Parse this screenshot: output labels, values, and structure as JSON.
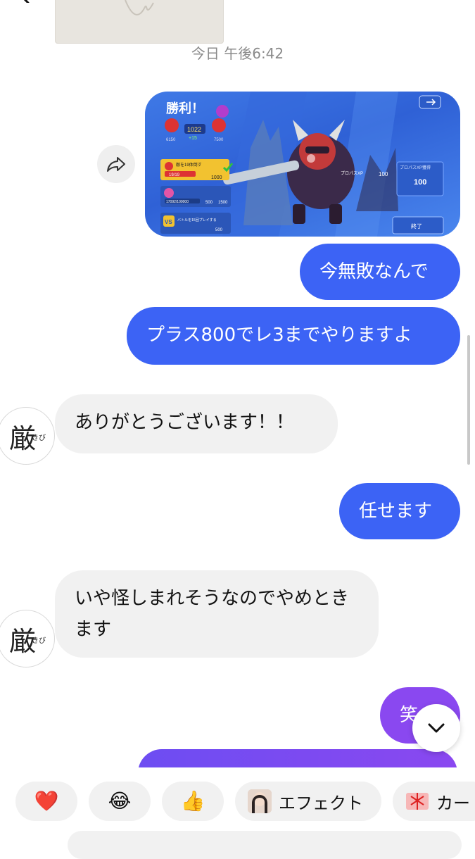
{
  "header": {
    "timestamp": "今日 午後6:42"
  },
  "shared_image": {
    "victory_title": "勝利！",
    "trophies": "1022",
    "trophies_change": "+15",
    "left_score": "6150",
    "right_score": "7500",
    "quest1": "敵を19体倒す",
    "quest1_progress": "19/19",
    "quest1_reward": "1000",
    "quest2_progress": "17092/100000",
    "quest2_reward_a": "500",
    "quest2_reward_b": "1500",
    "quest3": "バトルを15回プレイする",
    "quest3_reward": "500",
    "probass_xp_label": "プロパスXP",
    "probass_xp_value": "100",
    "bonus_label": "プロパスXP獲得",
    "bonus_value": "100",
    "finish_button": "終了"
  },
  "messages": [
    {
      "dir": "out",
      "text": "今無敗なんで"
    },
    {
      "dir": "out",
      "text": "プラス800でレ3までやりますよ"
    },
    {
      "dir": "in",
      "text": "ありがとうございます！！"
    },
    {
      "dir": "out",
      "text": "任せます"
    },
    {
      "dir": "in",
      "text": "いや怪しまれそうなのでやめときます"
    },
    {
      "dir": "out",
      "text": "笑"
    }
  ],
  "avatar": {
    "char": "厳",
    "small": "きび"
  },
  "reactions": {
    "heart": "❤️",
    "laugh": "😂",
    "thumbs": "👍",
    "effect_label": "エフェクト",
    "card_label": "カー"
  },
  "colors": {
    "outgoing": "#3c63f5",
    "incoming": "#f1f1f1",
    "outgoing_last": "#8a48f0"
  }
}
